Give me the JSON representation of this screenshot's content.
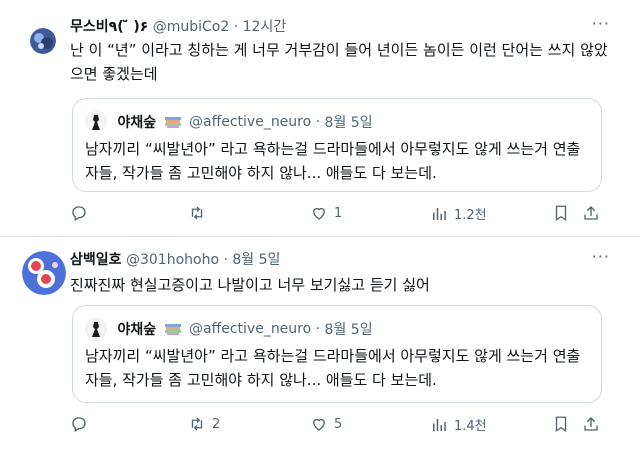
{
  "tweet1": {
    "display_name": "무스비٩( ̆̈ )۶",
    "handle": "@mubiCo2",
    "separator": "·",
    "time": "12시간",
    "text": "난 이 “년” 이라고 칭하는 게 너무 거부감이 들어 년이든 놈이든 이런 단어는 쓰지 않았으면 좋겠는데",
    "quote": {
      "name": "야채숲",
      "handle": "@affective_neuro",
      "separator": "·",
      "date": "8월 5일",
      "text": "남자끼리 “씨발년아” 라고 욕하는걸 드라마들에서 아무렇지도 않게 쓰는거 연출자들, 작가들 좀 고민해야 하지 않나... 애들도 다 보는데."
    },
    "actions": {
      "replies": "",
      "retweets": "",
      "likes": "1",
      "views": "1.2천"
    }
  },
  "tweet2": {
    "display_name": "삼백일호",
    "handle": "@301hohoho",
    "separator": "·",
    "time": "8월 5일",
    "text": "진짜진짜 현실고증이고 나발이고 너무 보기싫고 듣기 싫어",
    "quote": {
      "name": "야채숲",
      "handle": "@affective_neuro",
      "separator": "·",
      "date": "8월 5일",
      "text": "남자끼리 “씨발년아” 라고 욕하는걸 드라마들에서 아무렇지도 않게 쓰는거 연출자들, 작가들 좀 고민해야 하지 않나... 애들도 다 보는데."
    },
    "actions": {
      "replies": "",
      "retweets": "2",
      "likes": "5",
      "views": "1.4천"
    }
  },
  "more_label": "···",
  "icons": {
    "reply": "reply-icon",
    "retweet": "retweet-icon",
    "like": "heart-icon",
    "views": "views-icon",
    "bookmark": "bookmark-icon",
    "share": "share-icon"
  },
  "colors": {
    "text": "#0f1419",
    "secondary": "#536471",
    "border": "#cfd9de"
  }
}
